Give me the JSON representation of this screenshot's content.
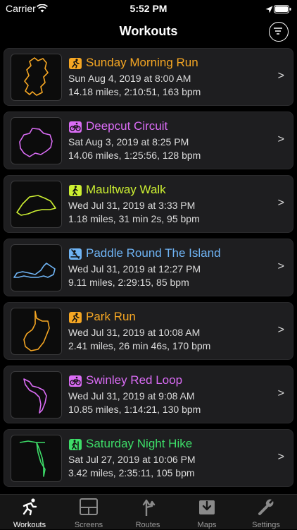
{
  "status_bar": {
    "carrier": "Carrier",
    "time": "5:52 PM"
  },
  "nav": {
    "title": "Workouts"
  },
  "workouts": [
    {
      "title": "Sunday Morning Run",
      "date": "Sun Aug 4, 2019 at 8:00 AM",
      "stats": "14.18 miles, 2:10:51, 163 bpm",
      "type_icon": "running-icon",
      "color": "#f5a623"
    },
    {
      "title": "Deepcut Circuit",
      "date": "Sat Aug 3, 2019 at 8:25 PM",
      "stats": "14.06 miles, 1:25:56, 128 bpm",
      "type_icon": "cycling-icon",
      "color": "#da6cf5"
    },
    {
      "title": "Maultway Walk",
      "date": "Wed Jul 31, 2019 at 3:33 PM",
      "stats": "1.18 miles, 31 min 2s, 95 bpm",
      "type_icon": "walking-icon",
      "color": "#cdf032"
    },
    {
      "title": "Paddle Round The Island",
      "date": "Wed Jul 31, 2019 at 12:27 PM",
      "stats": "9.11 miles, 2:29:15, 85 bpm",
      "type_icon": "paddling-icon",
      "color": "#6fb4f5"
    },
    {
      "title": "Park Run",
      "date": "Wed Jul 31, 2019 at 10:08 AM",
      "stats": "2.41 miles, 26 min 46s, 170 bpm",
      "type_icon": "running-icon",
      "color": "#f5a623"
    },
    {
      "title": "Swinley Red Loop",
      "date": "Wed Jul 31, 2019 at 9:08 AM",
      "stats": "10.85 miles, 1:14:21, 130 bpm",
      "type_icon": "cycling-icon",
      "color": "#da6cf5"
    },
    {
      "title": "Saturday Night Hike",
      "date": "Sat Jul 27, 2019 at 10:06 PM",
      "stats": "3.42 miles, 2:35:11, 105 bpm",
      "type_icon": "hiking-icon",
      "color": "#3ddc68"
    }
  ],
  "chevron": ">",
  "tabs": [
    {
      "label": "Workouts",
      "icon": "runner-icon"
    },
    {
      "label": "Screens",
      "icon": "screens-icon"
    },
    {
      "label": "Routes",
      "icon": "routes-icon"
    },
    {
      "label": "Maps",
      "icon": "maps-icon"
    },
    {
      "label": "Settings",
      "icon": "settings-icon"
    }
  ]
}
